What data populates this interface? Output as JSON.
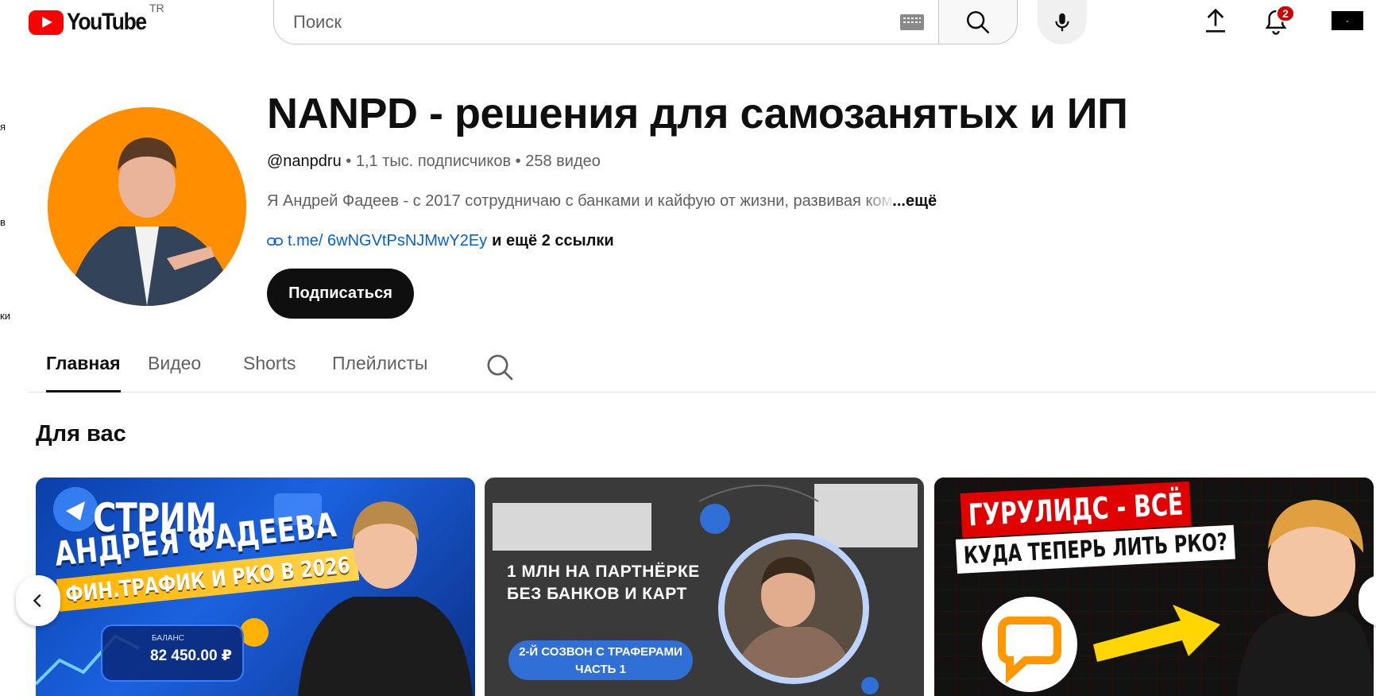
{
  "header": {
    "logo_text": "YouTube",
    "country_code": "TR",
    "search_placeholder": "Поиск",
    "notifications_count": "2"
  },
  "sidebar_fragments": [
    "я",
    "в",
    "ки"
  ],
  "channel": {
    "title": "NANPD - решения для самозанятых и ИП",
    "handle": "@nanpdru",
    "subscribers": "1,1 тыс. подписчиков",
    "video_count": "258 видео",
    "separator": " • ",
    "description": "Я Андрей Фадеев - с 2017 сотрудничаю с банками и кайфую от жизни, развивая ",
    "description_faded": "ком",
    "description_more": "...ещё",
    "link": "t.me/ 6wNGVtPsNJMwY2Ey",
    "more_links": "и ещё 2 ссылки",
    "subscribe_label": "Подписаться"
  },
  "tabs": [
    {
      "label": "Главная",
      "active": true
    },
    {
      "label": "Видео",
      "active": false
    },
    {
      "label": "Shorts",
      "active": false
    },
    {
      "label": "Плейлисты",
      "active": false
    }
  ],
  "section": {
    "title": "Для вас"
  },
  "videos": [
    {
      "line1": "СТРИМ",
      "line2": "АНДРЕЯ ФАДЕЕВА",
      "line3": "ФИН.ТРАФИК И РКО В 2026",
      "balance_label": "БАЛАНС",
      "balance_value": "82 450.00 ₽"
    },
    {
      "line1": "1 МЛН НА ПАРТНЁРКЕ",
      "line2": "БЕЗ БАНКОВ И КАРТ",
      "pill_line1": "2-Й СОЗВОН С ТРАФЕРАМИ",
      "pill_line2": "ЧАСТЬ 1"
    },
    {
      "line1": "ГУРУЛИДС - ВСЁ",
      "line2": "КУДА ТЕПЕРЬ ЛИТЬ РКО?"
    }
  ],
  "colors": {
    "brand_red": "#ff0000",
    "link_blue": "#065fd4",
    "avatar_bg": "#ff8f00"
  }
}
